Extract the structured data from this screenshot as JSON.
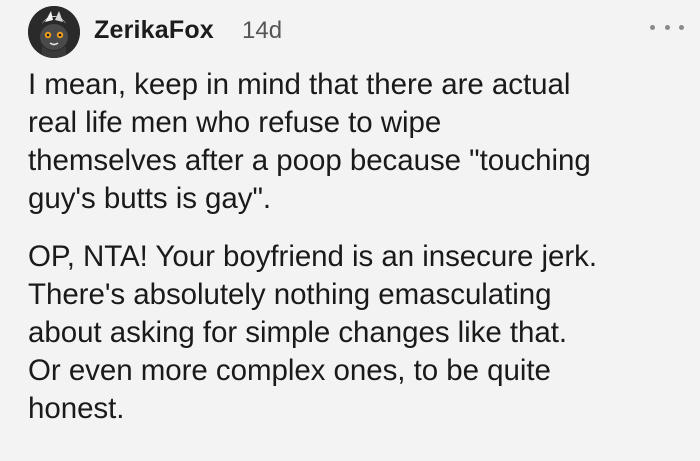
{
  "comment": {
    "author": "ZerikaFox",
    "timestamp": "14d",
    "more_icon": "more-horizontal-icon",
    "paragraphs": [
      {
        "lines": [
          "I mean, keep in mind that there are actual",
          "real life men who refuse to wipe",
          "themselves after a poop because \"touching",
          "guy's butts is gay\"."
        ]
      },
      {
        "lines": [
          "OP, NTA! Your boyfriend is an insecure jerk.",
          "There's absolutely nothing emasculating",
          "about asking for simple changes like that.",
          "Or even more complex ones, to be quite",
          "honest."
        ]
      }
    ]
  },
  "colors": {
    "background": "#f3f3f3",
    "text": "#1a1a1b",
    "meta": "#555555",
    "icon": "#8a8a8a"
  }
}
